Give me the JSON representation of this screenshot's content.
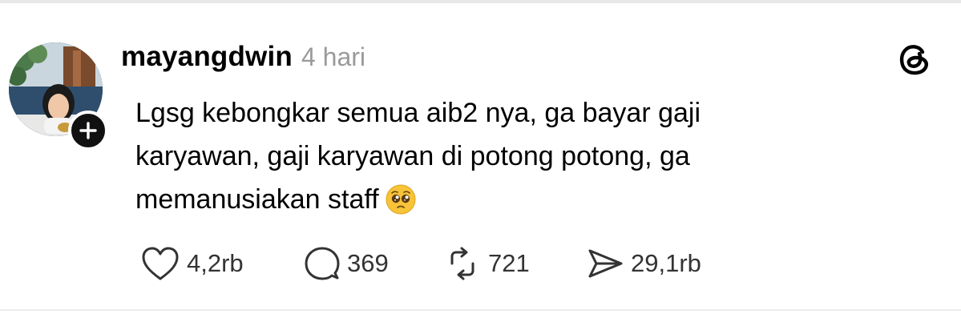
{
  "post": {
    "username": "mayangdwin",
    "time": "4 hari",
    "text_lines": [
      "Lgsg kebongkar semua aib2 nya, ga bayar gaji",
      "karyawan, gaji karyawan di potong potong, ga",
      "memanusiakan staff"
    ],
    "emoji": "pleading-face-icon"
  },
  "actions": {
    "likes": "4,2rb",
    "replies": "369",
    "reposts": "721",
    "shares": "29,1rb"
  },
  "icons": {
    "logo": "threads-logo-icon",
    "follow": "plus-icon",
    "like": "heart-icon",
    "reply": "speech-bubble-icon",
    "repost": "repost-icon",
    "share": "send-icon"
  },
  "colors": {
    "text": "#000000",
    "muted": "#9a9a9a",
    "badge": "#111111"
  }
}
